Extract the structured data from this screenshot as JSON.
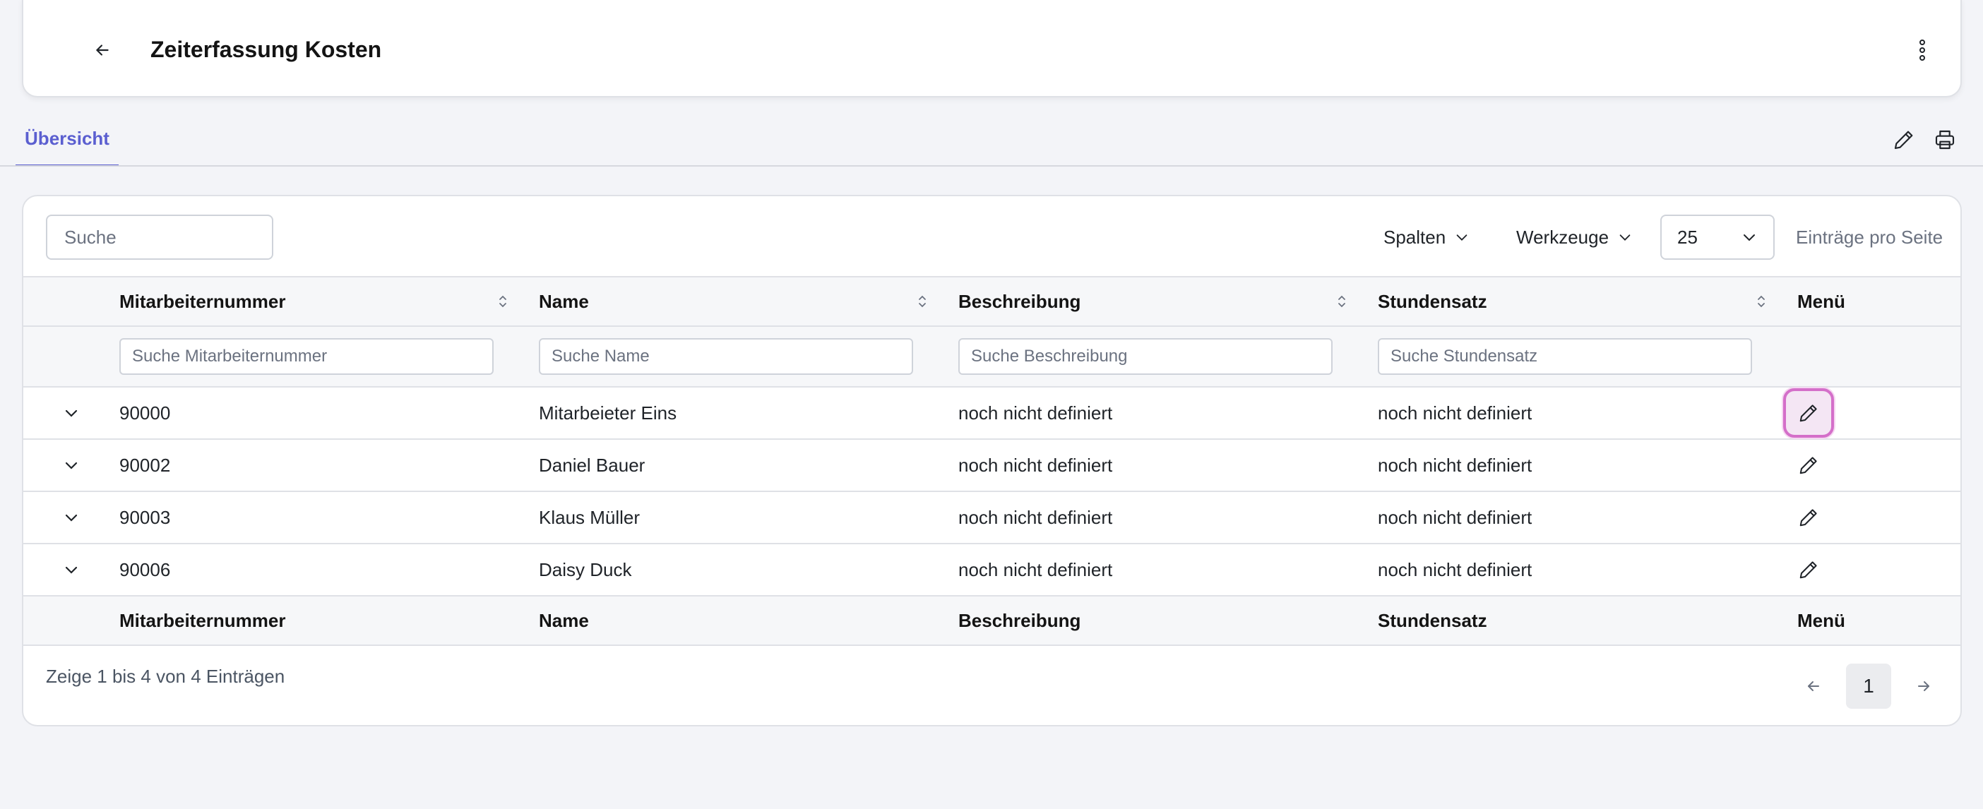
{
  "header": {
    "title": "Zeiterfassung Kosten"
  },
  "tabs": [
    {
      "label": "Übersicht",
      "active": true
    }
  ],
  "toolbar": {
    "search_placeholder": "Suche",
    "columns_label": "Spalten",
    "tools_label": "Werkzeuge",
    "per_page_value": "25",
    "per_page_label": "Einträge pro Seite"
  },
  "table": {
    "columns": [
      "Mitarbeiternummer",
      "Name",
      "Beschreibung",
      "Stundensatz",
      "Menü"
    ],
    "filters": [
      "Suche Mitarbeiternummer",
      "Suche Name",
      "Suche Beschreibung",
      "Suche Stundensatz"
    ],
    "rows": [
      {
        "nummer": "90000",
        "name": "Mitarbeieter Eins",
        "beschreibung": "noch nicht definiert",
        "stundensatz": "noch nicht definiert"
      },
      {
        "nummer": "90002",
        "name": "Daniel Bauer",
        "beschreibung": "noch nicht definiert",
        "stundensatz": "noch nicht definiert"
      },
      {
        "nummer": "90003",
        "name": "Klaus Müller",
        "beschreibung": "noch nicht definiert",
        "stundensatz": "noch nicht definiert"
      },
      {
        "nummer": "90006",
        "name": "Daisy Duck",
        "beschreibung": "noch nicht definiert",
        "stundensatz": "noch nicht definiert"
      }
    ]
  },
  "footer": {
    "info": "Zeige 1 bis 4 von 4 Einträgen",
    "current_page": "1"
  },
  "colors": {
    "accent": "#5b5fd0",
    "focus_ring": "#d46fc9"
  },
  "icons": [
    "back-arrow-icon",
    "kebab-menu-icon",
    "pencil-icon",
    "printer-icon",
    "chevron-down-icon",
    "sort-icon",
    "arrow-left-icon",
    "arrow-right-icon"
  ]
}
